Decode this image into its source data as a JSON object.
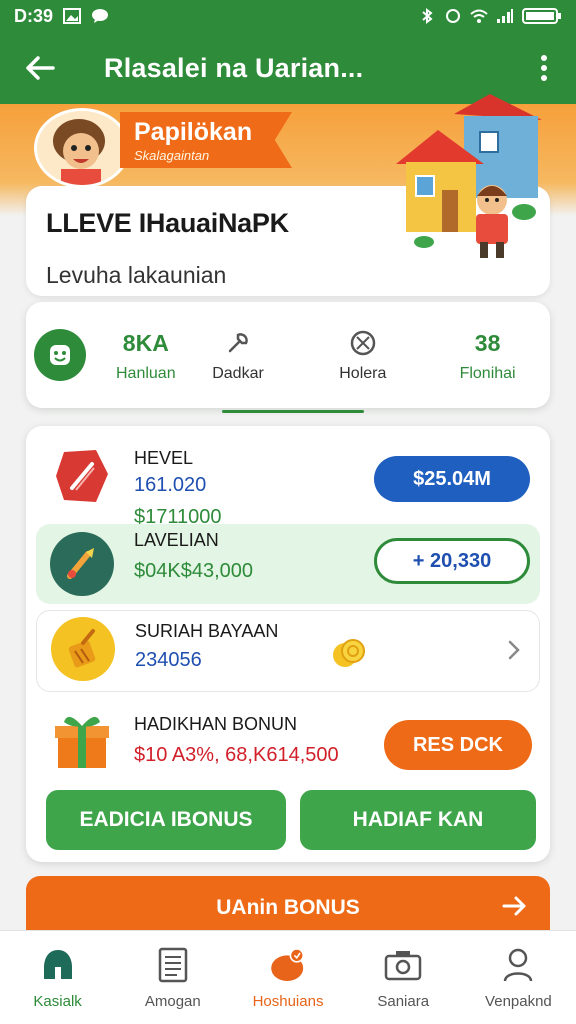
{
  "status_bar": {
    "time": "D:39"
  },
  "app_bar": {
    "title": "Rlasalei na Uarian..."
  },
  "banner": {
    "ribbon_title": "Papilökan",
    "ribbon_subtitle": "Skalagaintan"
  },
  "level": {
    "title": "LLEVE IHauaiNaPK",
    "subtitle": "Levuha lakaunian"
  },
  "stats": [
    {
      "value": "8KA",
      "label": "Hanluan"
    },
    {
      "value": "",
      "label": "Dadkar"
    },
    {
      "value": "",
      "label": "Holera"
    },
    {
      "value": "38",
      "label": "Flonihai"
    }
  ],
  "rows": [
    {
      "title": "HEVEL",
      "value1": "161.020",
      "value2": "$1711000",
      "action": "$25.04M"
    },
    {
      "title": "LAVELIAN",
      "value1": "$04K$43,000",
      "action": "+ 20,330"
    },
    {
      "title": "SURIAH BAYAAN",
      "value1": "234056"
    },
    {
      "title": "HADIKHAN BONUN",
      "value1": "$10 A3%, 68,K614,500",
      "action": "RES DCK"
    }
  ],
  "buttons": {
    "left": "EADICIA IBONUS",
    "right": "HADIAF KAN"
  },
  "orange_bar": {
    "label": "UAnin BONUS"
  },
  "nav": [
    {
      "label": "Kasialk"
    },
    {
      "label": "Amogan"
    },
    {
      "label": "Hoshuians"
    },
    {
      "label": "Saniara"
    },
    {
      "label": "Venpaknd"
    }
  ],
  "colors": {
    "primary_green": "#2e8b3a",
    "accent_orange": "#ee6a16",
    "pill_blue": "#1f5fbf",
    "pill_orange": "#ee6a16"
  }
}
